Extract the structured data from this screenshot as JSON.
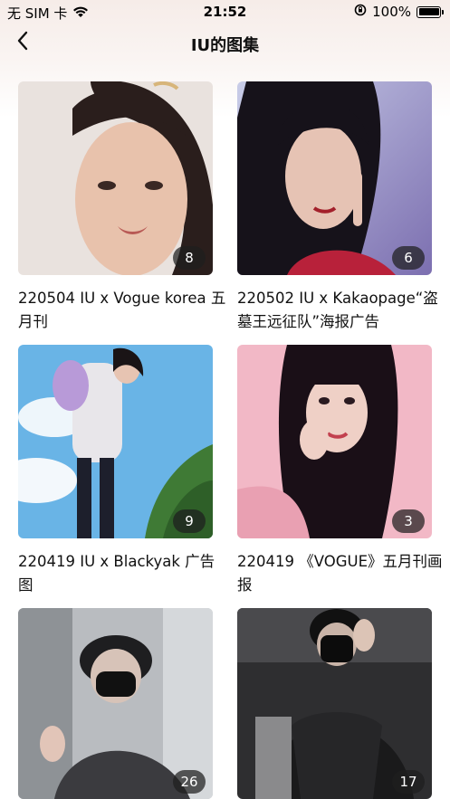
{
  "status_bar": {
    "carrier": "无 SIM 卡",
    "time": "21:52",
    "battery": "100%",
    "icons": [
      "wifi-icon",
      "orientation-lock-icon",
      "battery-icon"
    ]
  },
  "header": {
    "title": "IU的图集",
    "back_icon": "chevron-left-icon"
  },
  "albums": [
    {
      "caption": "220504 IU x Vogue korea 五月刊",
      "count": "8"
    },
    {
      "caption": "220502 IU x Kakaopage“盗墓王远征队”海报广告",
      "count": "6"
    },
    {
      "caption": "220419 IU x Blackyak 广告图",
      "count": "9"
    },
    {
      "caption": "220419 《VOGUE》五月刊画报",
      "count": "3"
    },
    {
      "caption": "",
      "count": "26"
    },
    {
      "caption": "",
      "count": "17"
    }
  ]
}
